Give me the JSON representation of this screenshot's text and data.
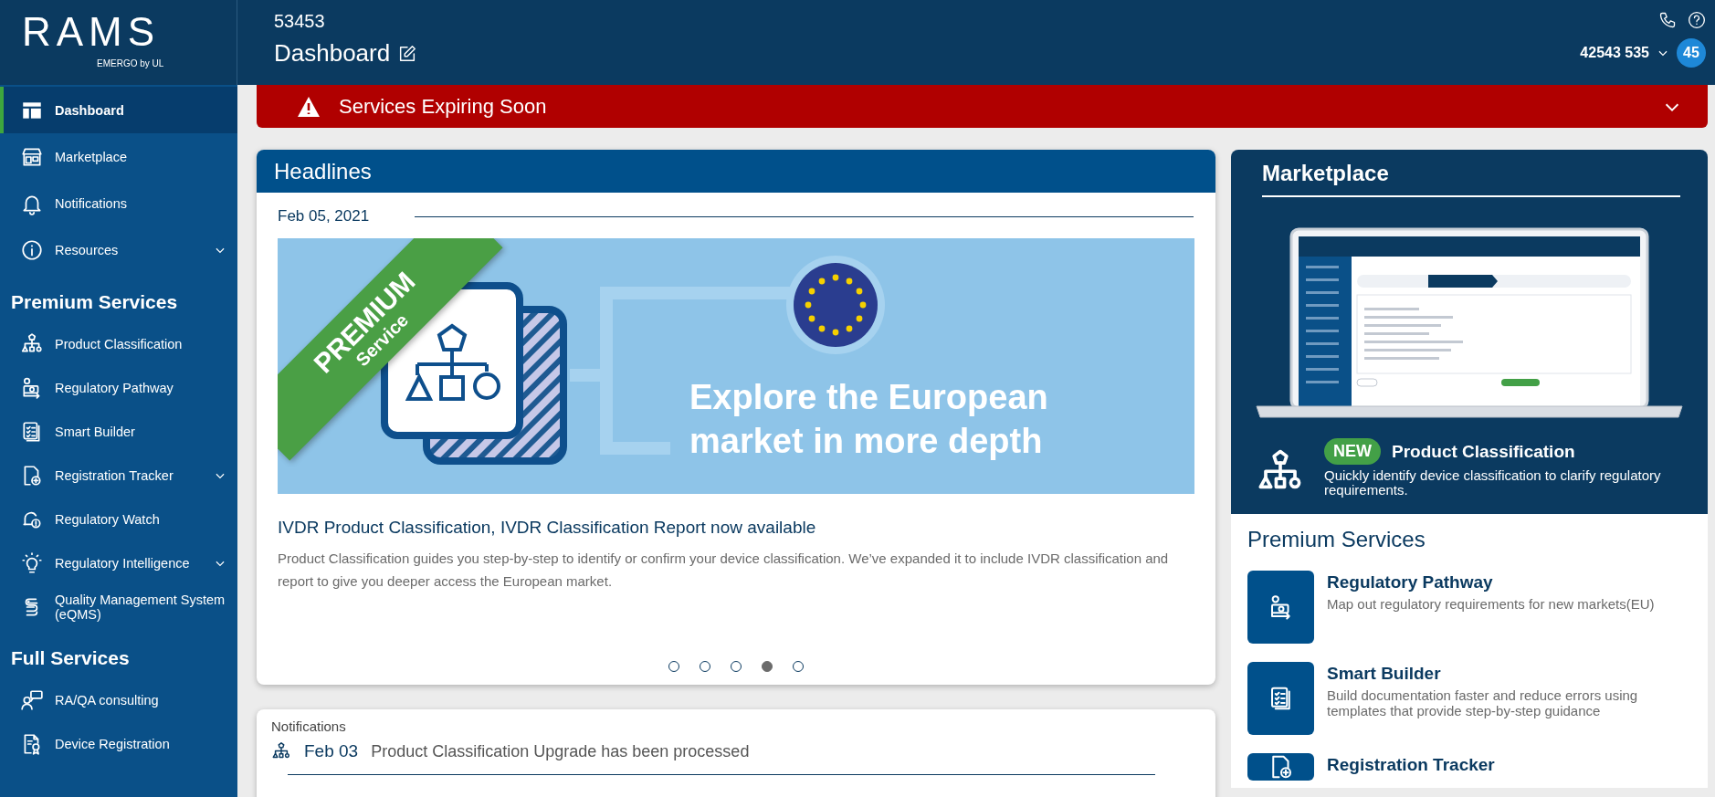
{
  "sidebar": {
    "logo": {
      "name": "RAMS",
      "tagline": "EMERGO by UL"
    },
    "items": [
      {
        "kind": "link",
        "label": "Dashboard",
        "selected": true,
        "expandable": false
      },
      {
        "kind": "link",
        "label": "Marketplace",
        "selected": false,
        "expandable": false
      },
      {
        "kind": "link",
        "label": "Notifications",
        "selected": false,
        "expandable": false
      },
      {
        "kind": "link",
        "label": "Resources",
        "selected": false,
        "expandable": true
      },
      {
        "kind": "heading",
        "label": "Premium Services"
      },
      {
        "kind": "link",
        "label": "Product Classification",
        "selected": false,
        "expandable": false
      },
      {
        "kind": "link",
        "label": "Regulatory Pathway",
        "selected": false,
        "expandable": false
      },
      {
        "kind": "link",
        "label": "Smart Builder",
        "selected": false,
        "expandable": false
      },
      {
        "kind": "link",
        "label": "Registration Tracker",
        "selected": false,
        "expandable": true
      },
      {
        "kind": "link",
        "label": "Regulatory Watch",
        "selected": false,
        "expandable": false
      },
      {
        "kind": "link",
        "label": "Regulatory Intelligence",
        "selected": false,
        "expandable": true
      },
      {
        "kind": "link",
        "label": "Quality Management System (eQMS)",
        "selected": false,
        "expandable": false
      },
      {
        "kind": "heading",
        "label": "Full Services"
      },
      {
        "kind": "link",
        "label": "RA/QA consulting",
        "selected": false,
        "expandable": false
      },
      {
        "kind": "link",
        "label": "Device Registration",
        "selected": false,
        "expandable": false
      }
    ]
  },
  "header": {
    "account_id": "53453",
    "page_title": "Dashboard",
    "user": "42543 535",
    "badge": "45"
  },
  "alert": {
    "title": "Services Expiring Soon",
    "expanded": false
  },
  "headlines": {
    "title": "Headlines",
    "date": "Feb 05, 2021",
    "banner": {
      "ribbon_title": "PREMIUM",
      "ribbon_subtitle": "Service",
      "headline": "Explore the European market in more depth"
    },
    "article_title": "IVDR Product Classification, IVDR Classification Report now available",
    "article_text": "Product Classification guides you step-by-step to identify or confirm your device classification. We’ve expanded it to include IVDR classification and report to give you deeper access the European market.",
    "slides": [
      {
        "selected": false
      },
      {
        "selected": false
      },
      {
        "selected": false
      },
      {
        "selected": true
      },
      {
        "selected": false
      }
    ]
  },
  "marketplace": {
    "title": "Marketplace",
    "badge": "NEW",
    "product": "Product Classification",
    "description": "Quickly identify device classification to clarify regulatory requirements."
  },
  "premium_services": {
    "title": "Premium Services",
    "items": [
      {
        "title": "Regulatory Pathway",
        "description": "Map out regulatory requirements for new markets(EU)"
      },
      {
        "title": "Smart Builder",
        "description": "Build documentation faster and reduce errors using templates that provide step-by-step guidance"
      },
      {
        "title": "Registration Tracker"
      }
    ]
  },
  "notifications": {
    "title": "Notifications",
    "items": [
      {
        "date": "Feb 03",
        "text": "Product Classification Upgrade has been processed"
      }
    ]
  }
}
